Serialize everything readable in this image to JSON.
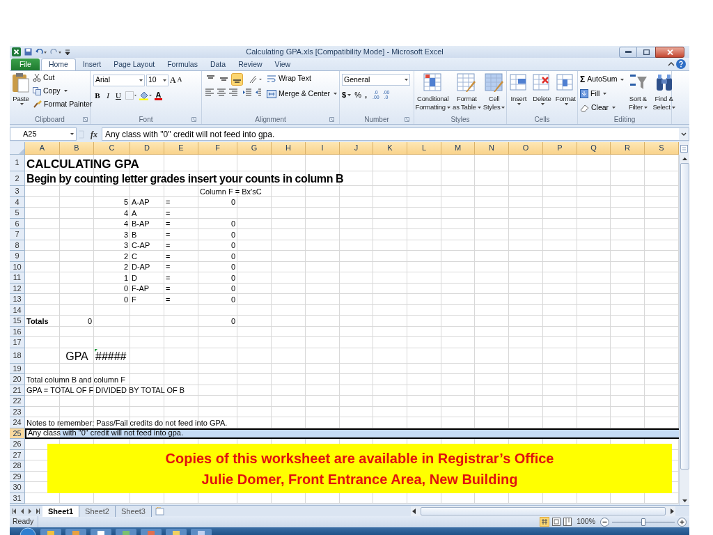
{
  "window": {
    "title": "Calculating GPA.xls [Compatibility Mode] - Microsoft Excel"
  },
  "ribbon_tabs": [
    {
      "label": "File",
      "kind": "file",
      "selected": false
    },
    {
      "label": "Home",
      "kind": "tab",
      "selected": true
    },
    {
      "label": "Insert",
      "kind": "tab",
      "selected": false
    },
    {
      "label": "Page Layout",
      "kind": "tab",
      "selected": false
    },
    {
      "label": "Formulas",
      "kind": "tab",
      "selected": false
    },
    {
      "label": "Data",
      "kind": "tab",
      "selected": false
    },
    {
      "label": "Review",
      "kind": "tab",
      "selected": false
    },
    {
      "label": "View",
      "kind": "tab",
      "selected": false
    }
  ],
  "ribbon": {
    "clipboard": {
      "label": "Clipboard",
      "paste": "Paste",
      "cut": "Cut",
      "copy": "Copy",
      "format_painter": "Format Painter"
    },
    "font": {
      "label": "Font",
      "font_name": "Arial",
      "font_size": "10",
      "grow": "A",
      "shrink": "A",
      "bold": "B",
      "italic": "I",
      "underline": "U",
      "font_color": "A"
    },
    "alignment": {
      "label": "Alignment",
      "vertical_align": [
        {
          "selected": false
        },
        {
          "selected": false
        },
        {
          "selected": true
        }
      ],
      "wrap_text": "Wrap Text",
      "merge_center": "Merge & Center"
    },
    "number": {
      "label": "Number",
      "format": "General",
      "currency": "$",
      "percent": "%",
      "comma": ",",
      "increase_decimal": {
        "top": ".0",
        "bottom": ".00"
      },
      "decrease_decimal": {
        "top": ".00",
        "bottom": ".0"
      }
    },
    "styles": {
      "label": "Styles",
      "buttons": [
        {
          "line1": "Conditional",
          "line2": "Formatting"
        },
        {
          "line1": "Format",
          "line2": "as Table"
        },
        {
          "line1": "Cell",
          "line2": "Styles"
        }
      ]
    },
    "cells": {
      "label": "Cells",
      "buttons": [
        "Insert",
        "Delete",
        "Format"
      ]
    },
    "editing": {
      "label": "Editing",
      "autosum_glyph": "Σ",
      "autosum": "AutoSum",
      "fill": "Fill",
      "clear": "Clear",
      "sort_filter": {
        "line1": "Sort &",
        "line2": "Filter"
      },
      "find_select": {
        "line1": "Find &",
        "line2": "Select"
      }
    }
  },
  "formula_bar": {
    "name_box": "A25",
    "fx": "fx",
    "content": "Any class with \"0\" credit will not feed into gpa."
  },
  "columns": [
    "A",
    "B",
    "C",
    "D",
    "E",
    "F",
    "G",
    "H",
    "I",
    "J",
    "K",
    "L",
    "M",
    "N",
    "O",
    "P",
    "Q",
    "R",
    "S"
  ],
  "rows": [
    {
      "number": "1",
      "kind": "title",
      "selected": false,
      "cells": {
        "A": {
          "text": "CALCULATING GPA",
          "kind": "text"
        }
      }
    },
    {
      "number": "2",
      "kind": "heading",
      "selected": false,
      "cells": {
        "A": {
          "text": "Begin by counting letter grades insert your counts in column B",
          "kind": "text"
        }
      }
    },
    {
      "number": "3",
      "kind": "normal",
      "selected": false,
      "cells": {
        "F": {
          "text": "Column F = Bx'sC",
          "kind": "text"
        }
      }
    },
    {
      "number": "4",
      "kind": "normal",
      "selected": false,
      "cells": {
        "C": {
          "text": "5",
          "kind": "number"
        },
        "D": {
          "text": "A-AP",
          "kind": "text"
        },
        "E": {
          "text": "=",
          "kind": "text"
        },
        "F": {
          "text": "0",
          "kind": "number"
        }
      }
    },
    {
      "number": "5",
      "kind": "normal",
      "selected": false,
      "cells": {
        "C": {
          "text": "4",
          "kind": "number"
        },
        "D": {
          "text": "A",
          "kind": "text"
        },
        "E": {
          "text": "=",
          "kind": "text"
        }
      }
    },
    {
      "number": "6",
      "kind": "normal",
      "selected": false,
      "cells": {
        "C": {
          "text": "4",
          "kind": "number"
        },
        "D": {
          "text": "B-AP",
          "kind": "text"
        },
        "E": {
          "text": "=",
          "kind": "text"
        },
        "F": {
          "text": "0",
          "kind": "number"
        }
      }
    },
    {
      "number": "7",
      "kind": "normal",
      "selected": false,
      "cells": {
        "C": {
          "text": "3",
          "kind": "number"
        },
        "D": {
          "text": "B",
          "kind": "text"
        },
        "E": {
          "text": "=",
          "kind": "text"
        },
        "F": {
          "text": "0",
          "kind": "number"
        }
      }
    },
    {
      "number": "8",
      "kind": "normal",
      "selected": false,
      "cells": {
        "C": {
          "text": "3",
          "kind": "number"
        },
        "D": {
          "text": "C-AP",
          "kind": "text"
        },
        "E": {
          "text": "=",
          "kind": "text"
        },
        "F": {
          "text": "0",
          "kind": "number"
        }
      }
    },
    {
      "number": "9",
      "kind": "normal",
      "selected": false,
      "cells": {
        "C": {
          "text": "2",
          "kind": "number"
        },
        "D": {
          "text": "C",
          "kind": "text"
        },
        "E": {
          "text": "=",
          "kind": "text"
        },
        "F": {
          "text": "0",
          "kind": "number"
        }
      }
    },
    {
      "number": "10",
      "kind": "normal",
      "selected": false,
      "cells": {
        "C": {
          "text": "2",
          "kind": "number"
        },
        "D": {
          "text": "D-AP",
          "kind": "text"
        },
        "E": {
          "text": "=",
          "kind": "text"
        },
        "F": {
          "text": "0",
          "kind": "number"
        }
      }
    },
    {
      "number": "11",
      "kind": "normal",
      "selected": false,
      "cells": {
        "C": {
          "text": "1",
          "kind": "number"
        },
        "D": {
          "text": "D",
          "kind": "text"
        },
        "E": {
          "text": "=",
          "kind": "text"
        },
        "F": {
          "text": "0",
          "kind": "number"
        }
      }
    },
    {
      "number": "12",
      "kind": "normal",
      "selected": false,
      "cells": {
        "C": {
          "text": "0",
          "kind": "number"
        },
        "D": {
          "text": "F-AP",
          "kind": "text"
        },
        "E": {
          "text": "=",
          "kind": "text"
        },
        "F": {
          "text": "0",
          "kind": "number"
        }
      }
    },
    {
      "number": "13",
      "kind": "normal",
      "selected": false,
      "cells": {
        "C": {
          "text": "0",
          "kind": "number"
        },
        "D": {
          "text": "F",
          "kind": "text"
        },
        "E": {
          "text": "=",
          "kind": "text"
        },
        "F": {
          "text": "0",
          "kind": "number"
        }
      }
    },
    {
      "number": "14",
      "kind": "normal",
      "selected": false
    },
    {
      "number": "15",
      "kind": "normal",
      "selected": false,
      "cells": {
        "A": {
          "text": "Totals",
          "kind": "text",
          "bold": true
        },
        "B": {
          "text": "0",
          "kind": "number"
        },
        "F": {
          "text": "0",
          "kind": "number"
        }
      }
    },
    {
      "number": "16",
      "kind": "normal",
      "selected": false
    },
    {
      "number": "17",
      "kind": "normal",
      "selected": false
    },
    {
      "number": "18",
      "kind": "large",
      "selected": false,
      "cells": {
        "B": {
          "text": "GPA",
          "kind": "centered"
        },
        "C": {
          "text": "#####",
          "kind": "text",
          "error_flag": true
        }
      }
    },
    {
      "number": "19",
      "kind": "normal",
      "selected": false
    },
    {
      "number": "20",
      "kind": "normal",
      "selected": false,
      "cells": {
        "A": {
          "text": "Total column B and column F",
          "kind": "text"
        }
      }
    },
    {
      "number": "21",
      "kind": "normal",
      "selected": false,
      "cells": {
        "A": {
          "text": "GPA = TOTAL OF F DIVIDED BY TOTAL OF B",
          "kind": "text"
        }
      }
    },
    {
      "number": "22",
      "kind": "normal",
      "selected": false
    },
    {
      "number": "23",
      "kind": "normal",
      "selected": false
    },
    {
      "number": "24",
      "kind": "normal",
      "selected": false,
      "cells": {
        "A": {
          "text": "Notes to remember:  Pass/Fail credits do not feed into GPA.",
          "kind": "text"
        }
      }
    },
    {
      "number": "25",
      "kind": "normal",
      "selected": true,
      "cells": {
        "A": {
          "text": "Any class with \"0\" credit will not feed into gpa.",
          "kind": "text"
        }
      }
    },
    {
      "number": "26",
      "kind": "normal",
      "selected": false
    },
    {
      "number": "27",
      "kind": "normal",
      "selected": false
    },
    {
      "number": "28",
      "kind": "normal",
      "selected": false
    },
    {
      "number": "29",
      "kind": "normal",
      "selected": false
    },
    {
      "number": "30",
      "kind": "normal",
      "selected": false
    },
    {
      "number": "31",
      "kind": "normal",
      "selected": false
    }
  ],
  "callout": {
    "lines": [
      "Copies of this worksheet are available in Registrar’s Office",
      "Julie Domer, Front Entrance Area, New Building"
    ]
  },
  "sheet_tabs": [
    {
      "label": "Sheet1",
      "selected": true
    },
    {
      "label": "Sheet2",
      "selected": false
    },
    {
      "label": "Sheet3",
      "selected": false
    }
  ],
  "status_bar": {
    "status": "Ready",
    "zoom": "100%",
    "zoom_slider": {
      "level": 0.5
    }
  }
}
